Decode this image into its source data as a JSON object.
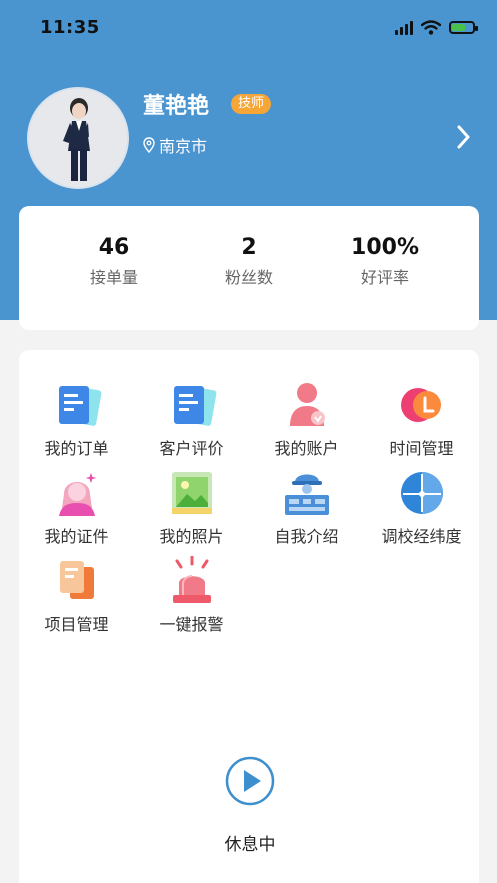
{
  "status_bar": {
    "time": "11:35"
  },
  "profile": {
    "name": "董艳艳",
    "role_badge": "技师",
    "location": "南京市"
  },
  "stats": [
    {
      "value": "46",
      "label": "接单量"
    },
    {
      "value": "2",
      "label": "粉丝数"
    },
    {
      "value": "100%",
      "label": "好评率"
    }
  ],
  "menu": [
    {
      "label": "我的订单",
      "icon": "orders-icon"
    },
    {
      "label": "客户评价",
      "icon": "reviews-icon"
    },
    {
      "label": "我的账户",
      "icon": "account-icon"
    },
    {
      "label": "时间管理",
      "icon": "time-icon"
    },
    {
      "label": "我的证件",
      "icon": "certificate-icon"
    },
    {
      "label": "我的照片",
      "icon": "photo-icon"
    },
    {
      "label": "自我介绍",
      "icon": "intro-icon"
    },
    {
      "label": "调校经纬度",
      "icon": "coordinates-icon"
    },
    {
      "label": "项目管理",
      "icon": "project-icon"
    },
    {
      "label": "一键报警",
      "icon": "alarm-icon"
    }
  ],
  "work_status": {
    "label": "休息中"
  },
  "colors": {
    "header": "#4a94d0",
    "badge": "#f6a637",
    "toggle": "#3e8fcd"
  }
}
